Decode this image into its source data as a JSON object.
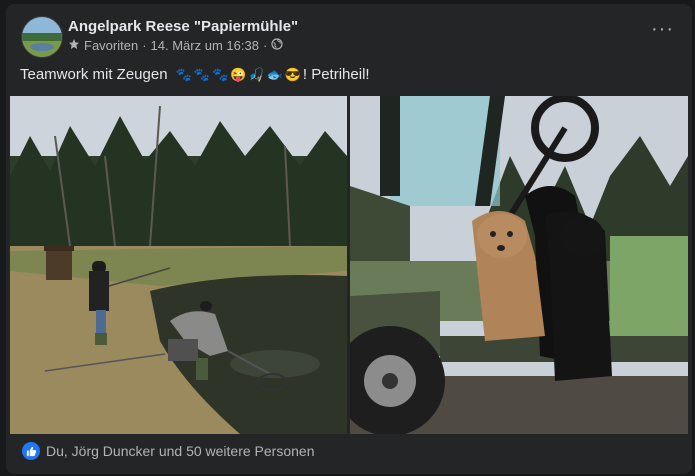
{
  "post": {
    "page_name": "Angelpark Reese \"Papiermühle\"",
    "favorites": "Favoriten",
    "separator": "·",
    "timestamp": "14. März um 16:38",
    "more_label": "···",
    "text_start": "Teamwork mit Zeugen",
    "text_end": "! Petriheil!",
    "emojis": [
      "🐾",
      "🐾",
      "🐾",
      "😜",
      "🎣",
      "🐟",
      "😎"
    ]
  },
  "reactions": {
    "summary": "Du, Jörg Duncker und 50 weitere Personen"
  },
  "colors": {
    "card_bg": "#242526",
    "text_primary": "#e4e6eb",
    "text_secondary": "#b0b3b8",
    "like_blue": "#2078f4"
  }
}
